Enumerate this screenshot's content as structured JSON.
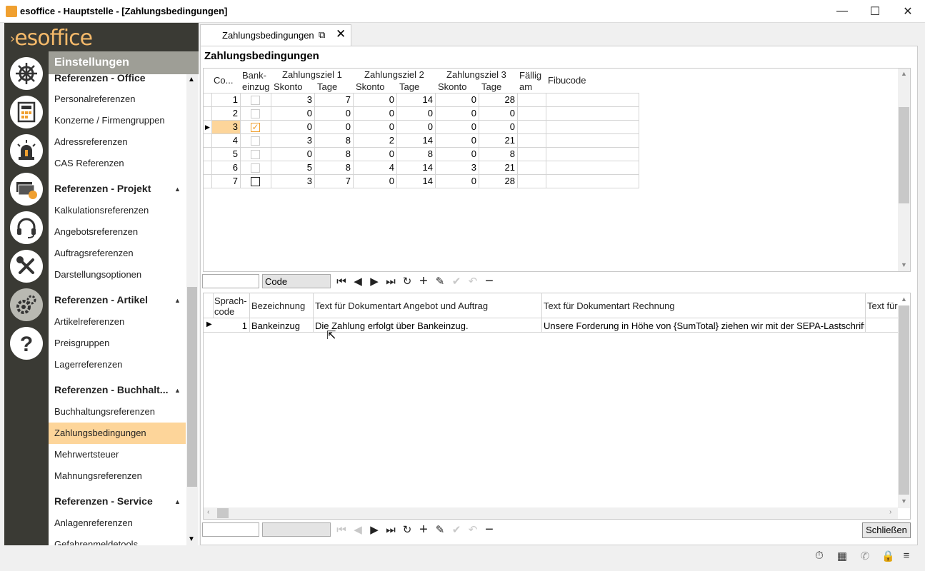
{
  "window": {
    "title": "esoffice - Hauptstelle - [Zahlungsbedingungen]",
    "minimize": "—",
    "maximize": "☐",
    "close": "✕"
  },
  "logo": {
    "text": "esoffice"
  },
  "rail": {
    "icons": [
      "helm-icon",
      "calculator-icon",
      "alarm-icon",
      "money-icon",
      "headset-icon",
      "tools-icon",
      "gears-icon",
      "help-icon"
    ]
  },
  "settings": {
    "title": "Einstellungen",
    "sections": [
      {
        "label": "Referenzen - Office",
        "items": [
          "Personalreferenzen",
          "Konzerne / Firmengruppen",
          "Adressreferenzen",
          "CAS Referenzen"
        ]
      },
      {
        "label": "Referenzen - Projekt",
        "items": [
          "Kalkulationsreferenzen",
          "Angebotsreferenzen",
          "Auftragsreferenzen",
          "Darstellungsoptionen"
        ]
      },
      {
        "label": "Referenzen - Artikel",
        "items": [
          "Artikelreferenzen",
          "Preisgruppen",
          "Lagerreferenzen"
        ]
      },
      {
        "label": "Referenzen - Buchhalt...",
        "items": [
          "Buchhaltungsreferenzen",
          "Zahlungsbedingungen",
          "Mehrwertsteuer",
          "Mahnungsreferenzen"
        ]
      },
      {
        "label": "Referenzen - Service",
        "items": [
          "Anlagenreferenzen",
          "Gefahrenmeldetools"
        ]
      }
    ],
    "selected": "Zahlungsbedingungen"
  },
  "tab": {
    "label": "Zahlungsbedingungen"
  },
  "page_title": "Zahlungsbedingungen",
  "top_grid": {
    "headers": {
      "code": "Co...",
      "bankeinzug": [
        "Bank-",
        "einzug"
      ],
      "ziel1": "Zahlungsziel 1",
      "ziel2": "Zahlungsziel 2",
      "ziel3": "Zahlungsziel 3",
      "skonto": "Skonto",
      "tage": "Tage",
      "faellig": [
        "Fällig",
        "am"
      ],
      "fibucode": "Fibucode"
    },
    "rows": [
      {
        "code": "1",
        "bank": false,
        "s1": "3",
        "t1": "7",
        "s2": "0",
        "t2": "14",
        "s3": "0",
        "t3": "28"
      },
      {
        "code": "2",
        "bank": false,
        "s1": "0",
        "t1": "0",
        "s2": "0",
        "t2": "0",
        "s3": "0",
        "t3": "0"
      },
      {
        "code": "3",
        "bank": true,
        "s1": "0",
        "t1": "0",
        "s2": "0",
        "t2": "0",
        "s3": "0",
        "t3": "0"
      },
      {
        "code": "4",
        "bank": false,
        "s1": "3",
        "t1": "8",
        "s2": "2",
        "t2": "14",
        "s3": "0",
        "t3": "21"
      },
      {
        "code": "5",
        "bank": false,
        "s1": "0",
        "t1": "8",
        "s2": "0",
        "t2": "8",
        "s3": "0",
        "t3": "8"
      },
      {
        "code": "6",
        "bank": false,
        "s1": "5",
        "t1": "8",
        "s2": "4",
        "t2": "14",
        "s3": "3",
        "t3": "21"
      },
      {
        "code": "7",
        "bank": false,
        "s1": "3",
        "t1": "7",
        "s2": "0",
        "t2": "14",
        "s3": "0",
        "t3": "28"
      }
    ],
    "selected_code": "3"
  },
  "top_navigator": {
    "search_value": "",
    "field_value": "Code"
  },
  "bottom_grid": {
    "headers": {
      "sprachcode": [
        "Sprach-",
        "code"
      ],
      "bezeichnung": "Bezeichnung",
      "angebot": "Text für Dokumentart Angebot und Auftrag",
      "rechnung": "Text für Dokumentart Rechnung",
      "more": "Text für"
    },
    "rows": [
      {
        "code": "1",
        "bezeichnung": "Bankeinzug",
        "angebot": "Die Zahlung erfolgt über Bankeinzug.",
        "rechnung": "Unsere Forderung in Höhe von {SumTotal} ziehen wir mit der SEPA-Lastschrift"
      }
    ]
  },
  "bottom_navigator": {
    "search_value": "",
    "field_value": ""
  },
  "buttons": {
    "close": "Schließen"
  },
  "status_icons": [
    "timer-icon",
    "building-icon",
    "phone-icon",
    "lock-icon",
    "database-icon"
  ],
  "colors": {
    "accent": "#f0a030",
    "selection": "#fdd59a",
    "rail": "#3a3a34",
    "header": "#9e9e96"
  }
}
